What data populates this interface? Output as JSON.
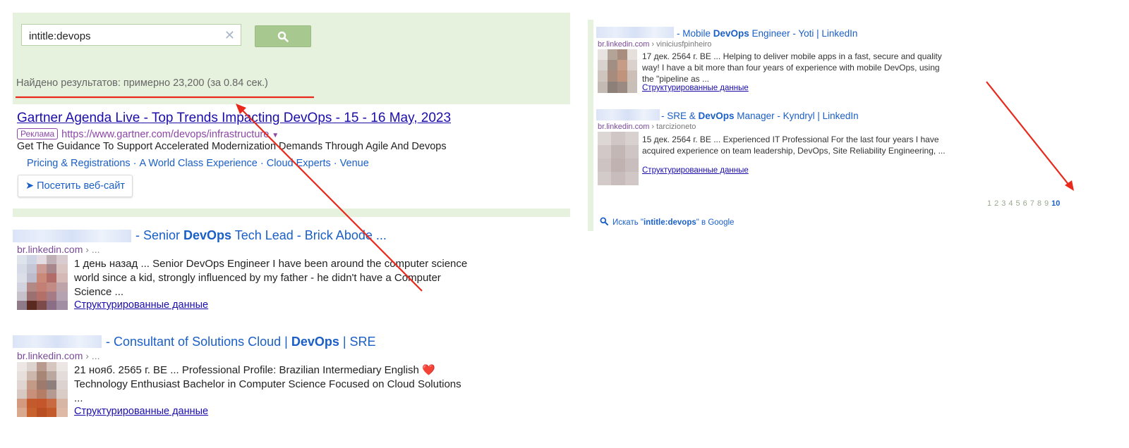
{
  "colors": {
    "panel_bg": "#e6f2dd",
    "link_blue": "#1a5fc8",
    "cite_purple": "#7a4a99",
    "annotation_red": "#e8291c"
  },
  "search": {
    "query": "intitle:devops",
    "clear_icon": "close-icon",
    "button_icon": "search-icon"
  },
  "result_count": "Найдено результатов: примерно 23,200 (за 0.84 сек.)",
  "ad": {
    "title": "Gartner Agenda Live - Top Trends Impacting DevOps - 15 - 16 May, 2023",
    "badge": "Реклама",
    "url": "https://www.gartner.com/devops/infrastructure",
    "caret": "▼",
    "description": "Get The Guidance To Support Accelerated Modernization Demands Through Agile And Devops",
    "sitelinks": [
      "Pricing & Registrations",
      "A World Class Experience",
      "Cloud Experts",
      "Venue"
    ],
    "sitelink_separator": "·",
    "visit_button": "Посетить веб-сайт",
    "visit_arrow": "➤"
  },
  "results_left": [
    {
      "title_pre": "- Senior ",
      "title_bold": "DevOps",
      "title_post": " Tech Lead - Brick Abode ...",
      "cite": "br.linkedin.com",
      "cite_sub": " › ...",
      "snippet": "1 день назад ... Senior DevOps Engineer I have been around the computer science world since a kid, strongly influenced by my father - he didn't have a Computer Science ...",
      "link": "Структурированные данные"
    },
    {
      "title_pre": "- Consultant of Solutions Cloud | ",
      "title_bold": "DevOps",
      "title_post": " | SRE",
      "cite": "br.linkedin.com",
      "cite_sub": " › ...",
      "snippet": "21 нояб. 2565 г. BE ... Professional Profile: Brazilian Intermediary English ❤️ Technology Enthusiast  Bachelor in Computer Science Focused on Cloud Solutions ...",
      "link": "Структурированные данные"
    }
  ],
  "results_right": [
    {
      "title_pre": "- Mobile ",
      "title_bold": "DevOps",
      "title_post": " Engineer - Yoti | LinkedIn",
      "cite": "br.linkedin.com",
      "cite_sub": " › viniciusfpinheiro",
      "snippet": "17 дек. 2564 г. BE ... Helping to deliver mobile apps in a fast, secure and quality way! I have a bit more than four years of experience with mobile DevOps, using the \"pipeline as ...",
      "link": "Структурированные данные"
    },
    {
      "title_pre": "- SRE & ",
      "title_bold": "DevOps",
      "title_post": " Manager - Kyndryl | LinkedIn",
      "cite": "br.linkedin.com",
      "cite_sub": " › tarcizioneto",
      "snippet": "15 дек. 2564 г. BE ... Experienced IT Professional For the last four years I have acquired experience on team leadership, DevOps, Site Reliability Engineering, ...",
      "link": "Структурированные данные"
    }
  ],
  "pagination": {
    "pages": [
      "1",
      "2",
      "3",
      "4",
      "5",
      "6",
      "7",
      "8",
      "9"
    ],
    "current": "10"
  },
  "google_search": {
    "pre": "Искать \"",
    "query": "intitle:devops",
    "post": "\" в Google"
  }
}
